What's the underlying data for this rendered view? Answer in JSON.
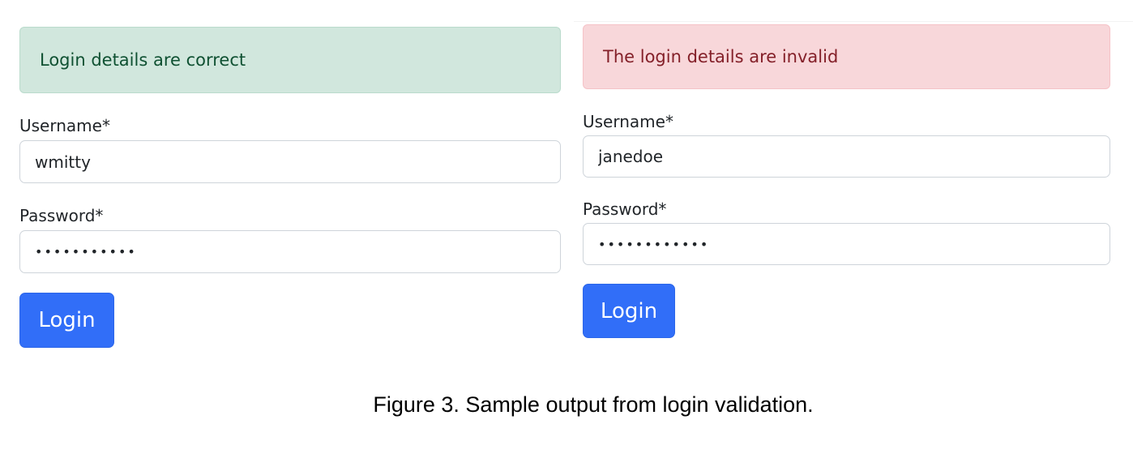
{
  "left_form": {
    "alert_text": "Login details are correct",
    "username_label": "Username*",
    "username_value": "wmitty",
    "password_label": "Password*",
    "password_value": "•••••••••••",
    "login_label": "Login"
  },
  "right_form": {
    "alert_text": "The login details are invalid",
    "username_label": "Username*",
    "username_value": "janedoe",
    "password_label": "Password*",
    "password_value": "••••••••••••",
    "login_label": "Login"
  },
  "caption": "Figure 3. Sample output from login validation.",
  "colors": {
    "success_bg": "#d1e7dd",
    "success_text": "#0f5132",
    "danger_bg": "#f8d7da",
    "danger_text": "#842029",
    "primary_button": "#316ef8"
  }
}
